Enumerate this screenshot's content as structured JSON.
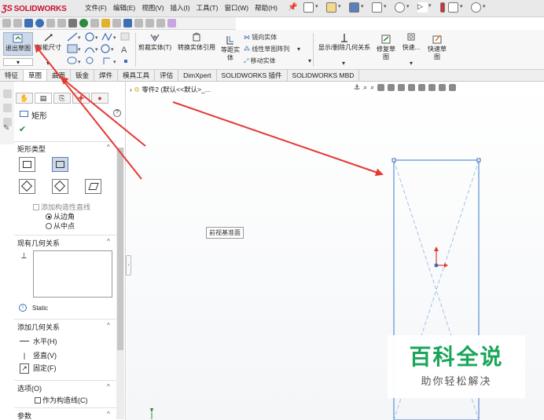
{
  "app": {
    "logo_text": "SOLIDWORKS",
    "menus": [
      "文件(F)",
      "编辑(E)",
      "视图(V)",
      "插入(I)",
      "工具(T)",
      "窗口(W)",
      "帮助(H)"
    ]
  },
  "ribbon": {
    "exit_sketch": "退出草图",
    "smart_dim": "智能尺寸",
    "trim": "剪裁实体(T)",
    "convert": "转换实体引用",
    "offset_a": "等距实",
    "offset_b": "体",
    "mirror": "镜向实体",
    "linear_pattern": "线性草图阵列",
    "move": "移动实体",
    "display_delete": "显示/删除几何关系",
    "repair_a": "修复草",
    "repair_b": "图",
    "quick_snap": "快速...",
    "quick_sketch_a": "快速草",
    "quick_sketch_b": "图"
  },
  "tabs": [
    {
      "label": "特征"
    },
    {
      "label": "草图"
    },
    {
      "label": "曲面"
    },
    {
      "label": "钣金"
    },
    {
      "label": "焊件"
    },
    {
      "label": "模具工具"
    },
    {
      "label": "评估"
    },
    {
      "label": "DimXpert"
    },
    {
      "label": "SOLIDWORKS 插件"
    },
    {
      "label": "SOLIDWORKS MBD"
    }
  ],
  "panel": {
    "title": "矩形",
    "help": "?",
    "rect_type_header": "矩形类型",
    "add_construction": "添加构造性直线",
    "from_corner": "从边角",
    "from_center": "从中点",
    "existing_relations_header": "现有几何关系",
    "status": "Static",
    "add_relations_header": "添加几何关系",
    "horizontal": "水平(H)",
    "vertical": "竖直(V)",
    "fix": "固定(F)",
    "options_header": "选项(O)",
    "construction_line": "作为构造线(C)",
    "params_header": "参数"
  },
  "canvas": {
    "tree_text": "零件2 (默认<<默认>_...",
    "plane_label": "前视基准面"
  },
  "watermark": {
    "title": "百科全说",
    "subtitle": "助你轻松解决"
  }
}
